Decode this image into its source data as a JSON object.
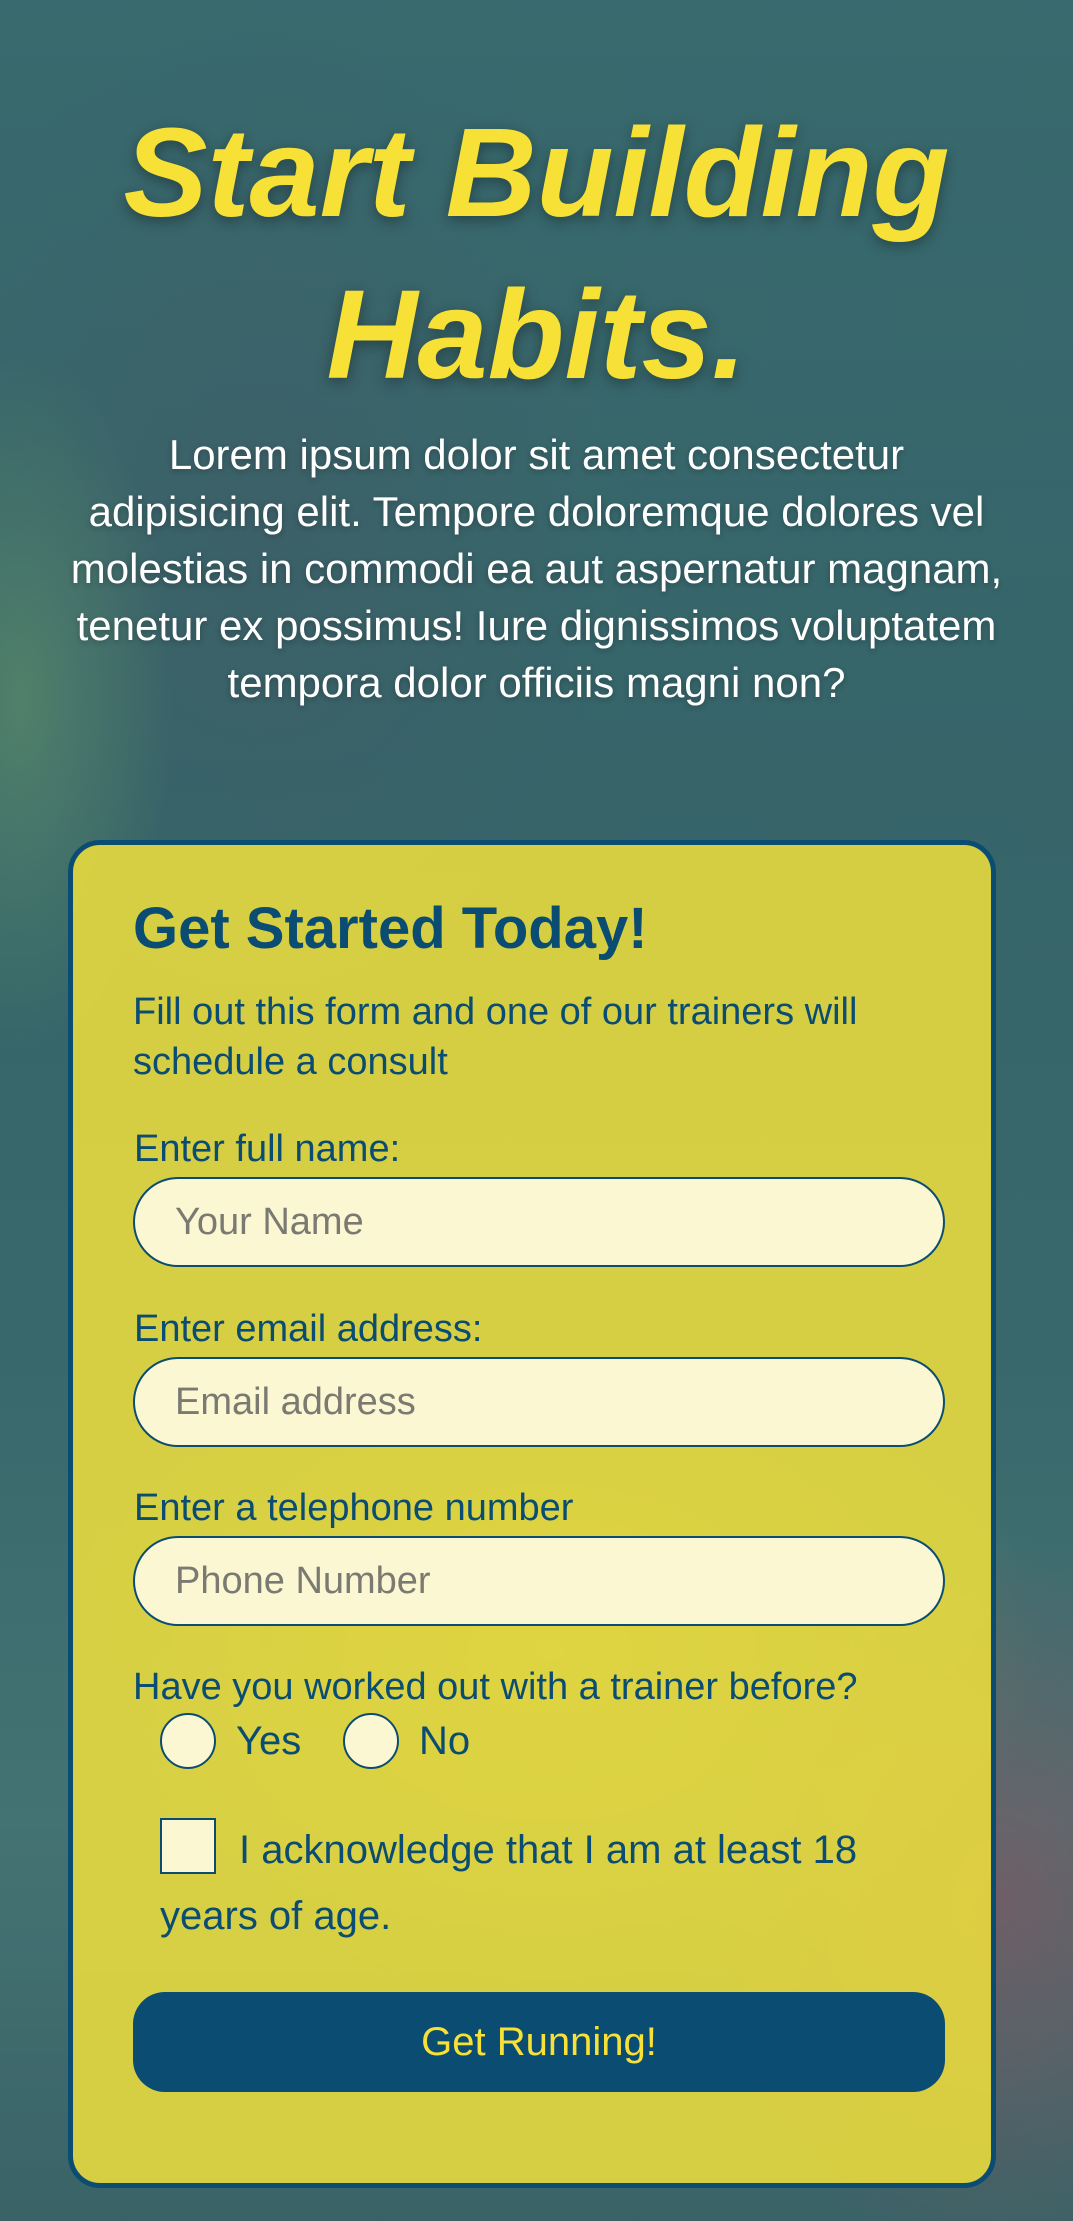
{
  "hero": {
    "title": "Start Building Habits.",
    "text": "Lorem ipsum dolor sit amet consectetur adipisicing elit. Tempore doloremque dolores vel molestias in commodi ea aut aspernatur magnam, tenetur ex possimus! Iure dignissimos voluptatem tempora dolor officiis magni non?"
  },
  "form": {
    "title": "Get Started Today!",
    "subtitle": "Fill out this form and one of our trainers will schedule a consult",
    "name": {
      "label": "Enter full name:",
      "placeholder": "Your Name",
      "value": ""
    },
    "email": {
      "label": "Enter email address:",
      "placeholder": "Email address",
      "value": ""
    },
    "phone": {
      "label": "Enter a telephone number",
      "placeholder": "Phone Number",
      "value": ""
    },
    "trainer_question": {
      "label": "Have you worked out with a trainer before?",
      "options": [
        "Yes",
        "No"
      ],
      "selected": null
    },
    "age_ack": {
      "label": "I acknowledge that I am at least 18 years of age.",
      "checked": false
    },
    "submit_label": "Get Running!"
  },
  "colors": {
    "accent_yellow": "#f7e137",
    "navy": "#0b4d72",
    "field_bg": "#fbf7d2"
  }
}
